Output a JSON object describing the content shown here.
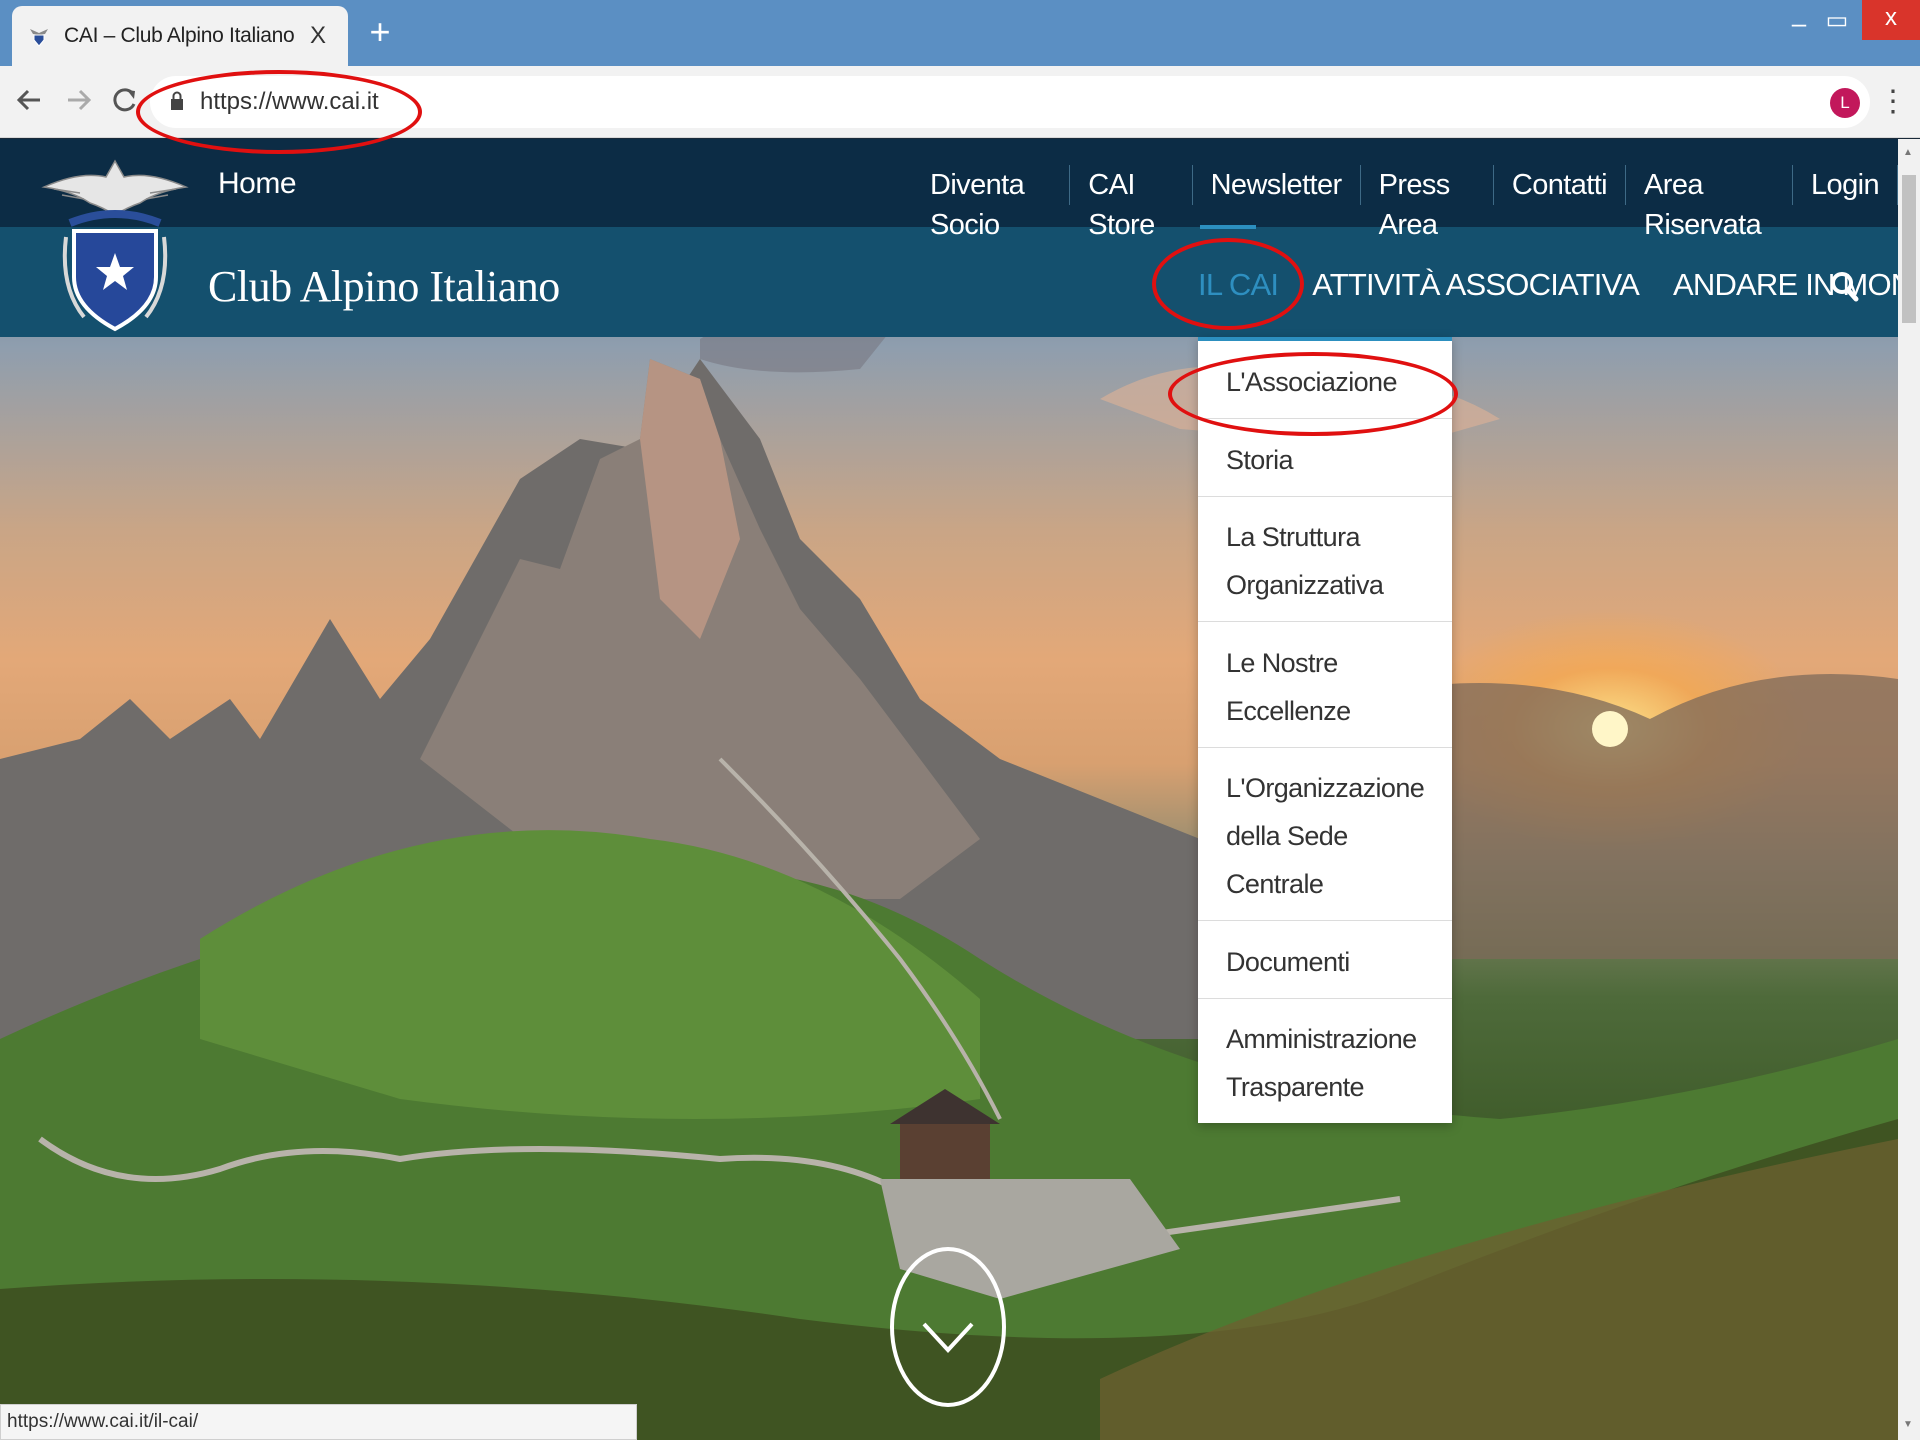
{
  "browser": {
    "tab_title": "CAI – Club Alpino Italiano",
    "tab_close": "X",
    "new_tab": "+",
    "url": "https://www.cai.it",
    "avatar_letter": "L",
    "status_url": "https://www.cai.it/il-cai/",
    "window_minimize": "–",
    "window_maximize": "▭",
    "window_close": "x"
  },
  "site": {
    "name": "Club Alpino Italiano",
    "home": "Home",
    "top_nav": [
      "Diventa Socio",
      "CAI Store",
      "Newsletter",
      "Press Area",
      "Contatti",
      "Area Riservata",
      "Login"
    ],
    "main_nav": [
      "IL CAI",
      "ATTIVITÀ ASSOCIATIVA",
      "ANDARE IN MONTAGNA"
    ],
    "active_main_nav": "IL CAI",
    "dropdown": [
      "L'Associazione",
      "Storia",
      "La Struttura Organizzativa",
      "Le Nostre Eccellenze",
      "L'Organizzazione della Sede Centrale",
      "Documenti",
      "Amministrazione Trasparente"
    ]
  },
  "colors": {
    "top_bar": "#0c2c45",
    "main_bar": "#14506e",
    "accent": "#2e8fc0",
    "annotation": "#e01010",
    "tabbar": "#5b8fc3"
  },
  "icons": [
    "cai-favicon-icon",
    "back-arrow-icon",
    "forward-arrow-icon",
    "reload-icon",
    "lock-icon",
    "bookmark-star-icon",
    "more-menu-icon",
    "search-icon",
    "chevron-down-icon"
  ]
}
